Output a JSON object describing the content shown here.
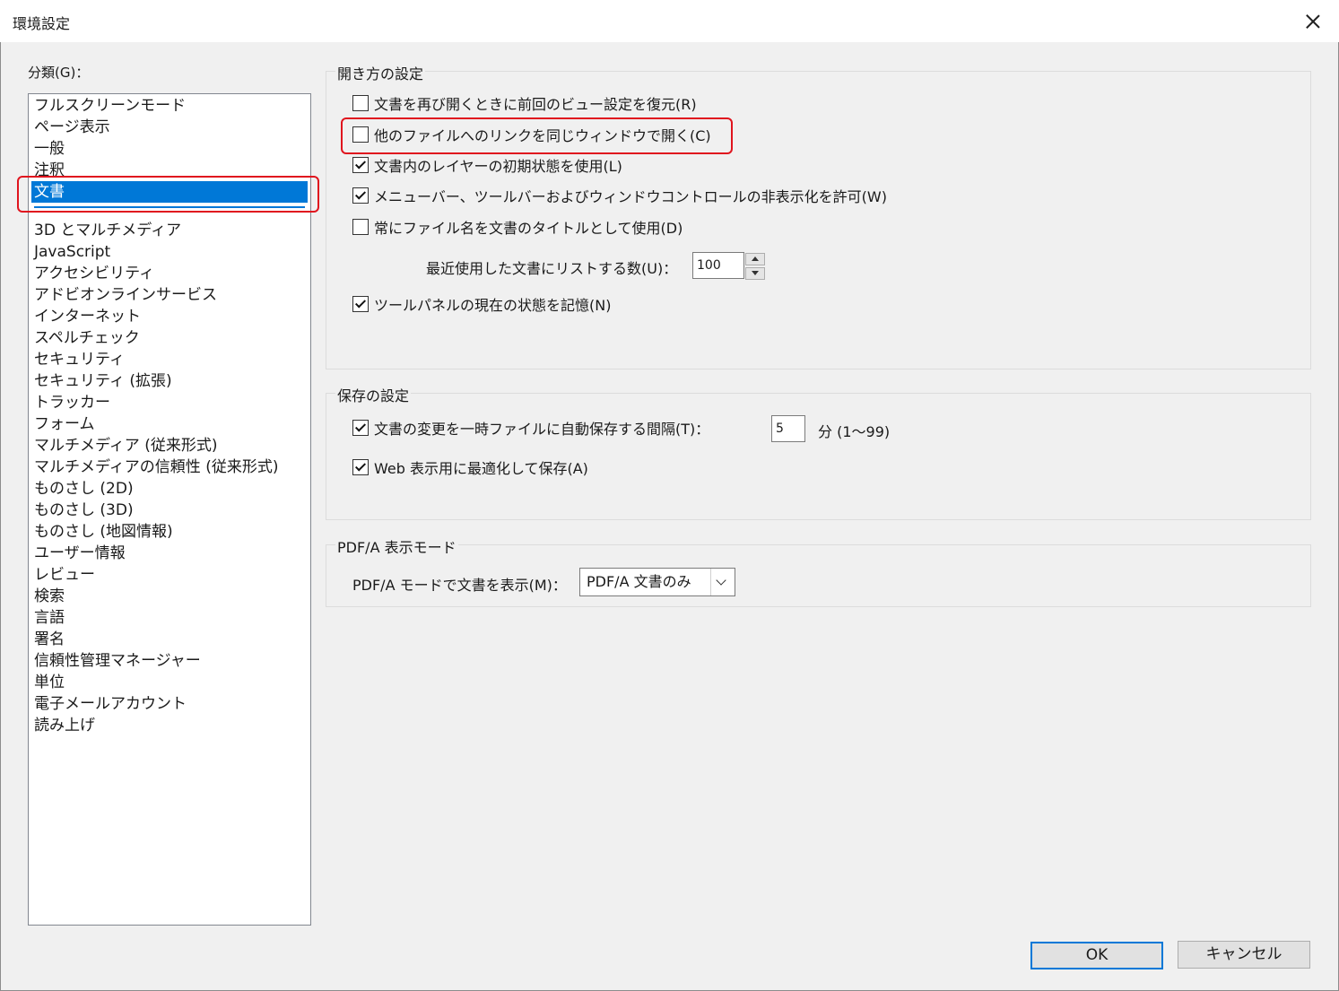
{
  "window": {
    "title": "環境設定"
  },
  "categories": {
    "label": "分類(G)：",
    "items_top": [
      "フルスクリーンモード",
      "ページ表示",
      "一般",
      "注釈"
    ],
    "selected": "文書",
    "items_bottom": [
      "3D とマルチメディア",
      "JavaScript",
      "アクセシビリティ",
      "アドビオンラインサービス",
      "インターネット",
      "スペルチェック",
      "セキュリティ",
      "セキュリティ (拡張)",
      "トラッカー",
      "フォーム",
      "マルチメディア (従来形式)",
      "マルチメディアの信頼性 (従来形式)",
      "ものさし (2D)",
      "ものさし (3D)",
      "ものさし (地図情報)",
      "ユーザー情報",
      "レビュー",
      "検索",
      "言語",
      "署名",
      "信頼性管理マネージャー",
      "単位",
      "電子メールアカウント",
      "読み上げ"
    ]
  },
  "open_settings": {
    "title": "開き方の設定",
    "restore_view": {
      "label": "文書を再び開くときに前回のビュー設定を復元(R)",
      "checked": false
    },
    "same_window": {
      "label": "他のファイルへのリンクを同じウィンドウで開く(C)",
      "checked": false
    },
    "layer_state": {
      "label": "文書内のレイヤーの初期状態を使用(L)",
      "checked": true
    },
    "allow_hide": {
      "label": "メニューバー、ツールバーおよびウィンドウコントロールの非表示化を許可(W)",
      "checked": true
    },
    "filename_title": {
      "label": "常にファイル名を文書のタイトルとして使用(D)",
      "checked": false
    },
    "recent_label": "最近使用した文書にリストする数(U)：",
    "recent_value": "100",
    "tool_panel": {
      "label": "ツールパネルの現在の状態を記憶(N)",
      "checked": true
    }
  },
  "save_settings": {
    "title": "保存の設定",
    "autosave": {
      "label": "文書の変更を一時ファイルに自動保存する間隔(T)：",
      "checked": true
    },
    "autosave_value": "5",
    "autosave_unit": "分 (1〜99)",
    "web_optimize": {
      "label": "Web 表示用に最適化して保存(A)",
      "checked": true
    }
  },
  "pdfa": {
    "title": "PDF/A 表示モード",
    "label": "PDF/A モードで文書を表示(M)：",
    "value": "PDF/A 文書のみ"
  },
  "buttons": {
    "ok": "OK",
    "cancel": "キャンセル"
  },
  "colors": {
    "selection": "#0078d7",
    "highlight": "#e0141e"
  }
}
